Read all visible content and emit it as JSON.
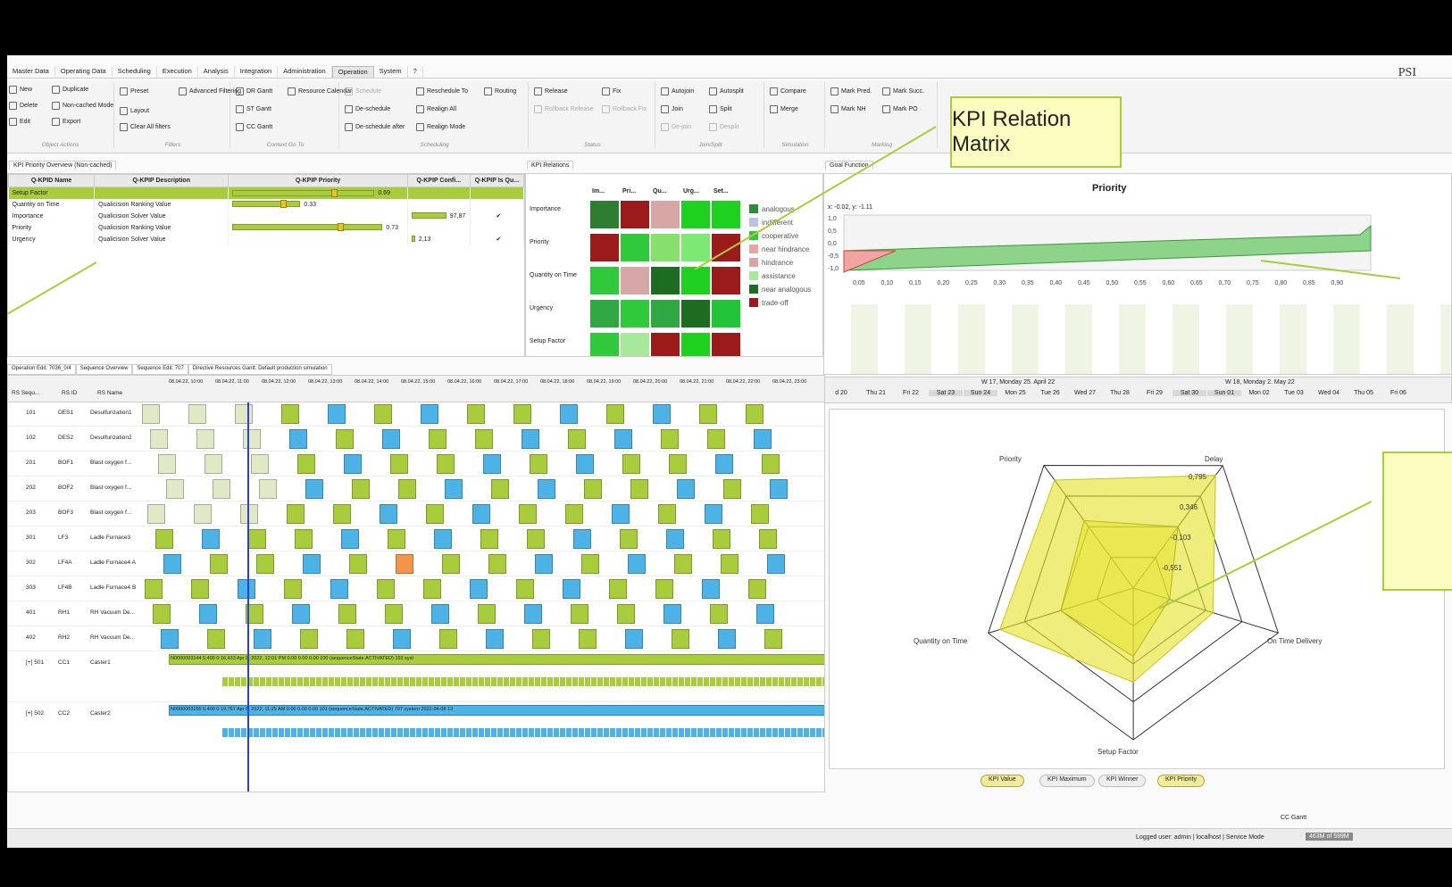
{
  "brand": "PSI",
  "menu": [
    "Master Data",
    "Operating Data",
    "Scheduling",
    "Execution",
    "Analysis",
    "Integration",
    "Administration",
    "Operation",
    "System",
    "?"
  ],
  "menu_active_index": 7,
  "ribbon": {
    "object_actions": {
      "label": "Object Actions",
      "new": "New",
      "duplicate": "Duplicate",
      "delete": "Delete",
      "non_cached": "Non-cached Mode",
      "edit": "Edit",
      "export": "Export"
    },
    "filters": {
      "label": "Filters",
      "preset": "Preset",
      "advanced": "Advanced Filtering",
      "layout": "Layout",
      "clear": "Clear All filters"
    },
    "context": {
      "label": "Context Go To",
      "dr_gantt": "DR Gantt",
      "resource_calendar": "Resource Calendar",
      "st_gantt": "ST Gantt",
      "cc_gantt": "CC Gantt"
    },
    "scheduling": {
      "label": "Scheduling",
      "schedule": "Schedule",
      "reschedule_to": "Reschedule To",
      "routing": "Routing",
      "deschedule": "De-schedule",
      "realign_all": "Realign All",
      "deschedule_after": "De-schedule after",
      "realign_mode": "Realign Mode"
    },
    "status": {
      "label": "Status",
      "release": "Release",
      "fix": "Fix",
      "rollback_release": "Rollback Release",
      "rollback_fix": "Rollback Fix"
    },
    "join_split": {
      "label": "Join/Split",
      "autojoin": "Autojoin",
      "autosplit": "Autosplit",
      "join": "Join",
      "split": "Split",
      "dejoin": "De-join",
      "desplit": "Desplit"
    },
    "simulation": {
      "label": "Simulation",
      "compare": "Compare",
      "merge": "Merge"
    },
    "marking": {
      "label": "Marking",
      "mark_pred": "Mark Pred.",
      "mark_succ": "Mark Succ.",
      "mark_nh": "Mark NH",
      "mark_po": "Mark PO"
    }
  },
  "priority_panel": {
    "tab": "KPI Priority Overview (Non-cached)",
    "columns": [
      "Q-KPID Name",
      "Q-KPIP Description",
      "Q-KPIP Priority",
      "Q-KPIP Confi...",
      "Q-KPIP Is Qu..."
    ],
    "rows": [
      {
        "name": "Setup Factor",
        "desc": "",
        "priority": 0.69,
        "priority_text": "0.69",
        "conf": null,
        "conf_text": "",
        "is_qu": ""
      },
      {
        "name": "Quantity on Time",
        "desc": "Qualicision Ranking Value",
        "priority": 0.33,
        "priority_text": "0.33",
        "conf": null,
        "conf_text": "",
        "is_qu": ""
      },
      {
        "name": "Importance",
        "desc": "Qualicision Solver Value",
        "priority": null,
        "priority_text": "",
        "conf": 0.98,
        "conf_text": "97,87",
        "is_qu": "✔"
      },
      {
        "name": "Priority",
        "desc": "Qualicision Ranking Value",
        "priority": 0.73,
        "priority_text": "0.73",
        "conf": null,
        "conf_text": "",
        "is_qu": ""
      },
      {
        "name": "Urgency",
        "desc": "Qualicision Solver Value",
        "priority": null,
        "priority_text": "",
        "conf": 0.1,
        "conf_text": "2,13",
        "is_qu": "✔"
      }
    ]
  },
  "relations_panel": {
    "tab": "KPI Relations",
    "columns": [
      "Im...",
      "Pri...",
      "Qu...",
      "Urg...",
      "Set..."
    ],
    "rows": [
      "Importance",
      "Priority",
      "Quantity on Time",
      "Urgency",
      "Setup Factor"
    ],
    "matrix": [
      [
        "#2e7d32",
        "#9b1b1b",
        "#d7a7a7",
        "#1fd11f",
        "#1fd11f"
      ],
      [
        "#9b1b1b",
        "#2fc93b",
        "#88e06c",
        "#7de873",
        "#9b1b1b"
      ],
      [
        "#2fc93b",
        "#d7a7a7",
        "#1e6b22",
        "#1fd11f",
        "#9b1b1b"
      ],
      [
        "#2fa844",
        "#2fc93b",
        "#2fa844",
        "#1e6b22",
        "#22c43a"
      ],
      [
        "#2fc93b",
        "#a8e89a",
        "#9b1b1b",
        "#1fd11f",
        "#9b1b1b"
      ]
    ],
    "legend": [
      {
        "label": "analogous",
        "color": "#2e8b3a"
      },
      {
        "label": "indifferent",
        "color": "#b9c3e6"
      },
      {
        "label": "cooperative",
        "color": "#2fc93b"
      },
      {
        "label": "near hindrance",
        "color": "#e8a3a3"
      },
      {
        "label": "hindrance",
        "color": "#d7a7a7"
      },
      {
        "label": "assistance",
        "color": "#a8e89a"
      },
      {
        "label": "near analogous",
        "color": "#1e6b22"
      },
      {
        "label": "trade-off",
        "color": "#9b1b1b"
      }
    ]
  },
  "callouts": {
    "kpi_relation_matrix": "KPI Relation Matrix"
  },
  "goal_panel": {
    "tab": "Goal Function",
    "chart_title": "Priority",
    "coords": "x: -0.02, y: -1.11",
    "y_ticks": [
      "1,0",
      "0,5",
      "0,0",
      "-0,5",
      "-1,0"
    ],
    "x_ticks": [
      "0,05",
      "0,10",
      "0,15",
      "0,20",
      "0,25",
      "0,30",
      "0,35",
      "0,40",
      "0,45",
      "0,50",
      "0,55",
      "0,60",
      "0,65",
      "0,70",
      "0,75",
      "0,80",
      "0,85",
      "0,90"
    ]
  },
  "timeline": {
    "weeks": [
      "W 17, Monday 25. April 22",
      "W 18, Monday 2. May 22"
    ],
    "days": [
      "d 20",
      "Thu 21",
      "Fri 22",
      "Sat 23",
      "Sun 24",
      "Mon 25",
      "Tue 26",
      "Wed 27",
      "Thu 28",
      "Fri 29",
      "Sat 30",
      "Sun 01",
      "Mon 02",
      "Tue 03",
      "Wed 04",
      "Thu 05",
      "Fri 06"
    ]
  },
  "radar": {
    "axes": [
      "Priority",
      "Delay",
      "On Time Delivery",
      "Setup Factor",
      "Quantity on Time"
    ],
    "ring_labels": [
      "0,795",
      "0,346",
      "-0,103",
      "-0,551"
    ],
    "outer": [
      0.88,
      0.92,
      0.55,
      0.62,
      0.92
    ],
    "inner": [
      0.55,
      0.5,
      0.25,
      0.45,
      0.5
    ],
    "buttons": [
      "KPI Value",
      "KPI Maximum",
      "KPI Winner",
      "KPI Priority"
    ],
    "active_buttons": [
      0,
      3
    ]
  },
  "gantt_tabs": [
    "Operation Edit: 7036_0/4",
    "Sequence Overview",
    "Sequence Edit: 707",
    "Directive Resources Gantt: Default production simulation"
  ],
  "gantt": {
    "columns": [
      "RS Sequ...",
      "RS ID",
      "RS Name"
    ],
    "rows": [
      {
        "seq": "101",
        "id": "DES1",
        "name": "Desulfurization1"
      },
      {
        "seq": "102",
        "id": "DES2",
        "name": "Desulfurization2"
      },
      {
        "seq": "201",
        "id": "BOF1",
        "name": "Blast oxygen f..."
      },
      {
        "seq": "202",
        "id": "BOF2",
        "name": "Blast oxygen f..."
      },
      {
        "seq": "203",
        "id": "BOF3",
        "name": "Blast oxygen f..."
      },
      {
        "seq": "301",
        "id": "LF3",
        "name": "Ladle Furnace3"
      },
      {
        "seq": "302",
        "id": "LF4A",
        "name": "Ladle Furnace4 A"
      },
      {
        "seq": "303",
        "id": "LF4B",
        "name": "Ladle Furnace4 B"
      },
      {
        "seq": "401",
        "id": "RH1",
        "name": "RH Vacuum De..."
      },
      {
        "seq": "402",
        "id": "RH2",
        "name": "RH Vacuum De..."
      },
      {
        "seq": "[+] 501",
        "id": "CC1",
        "name": "Caster1"
      },
      {
        "seq": "[+] 502",
        "id": "CC2",
        "name": "Caster2"
      }
    ],
    "time_header": [
      "08.04.22, 10:00",
      "08.04.22, 11:00",
      "08.04.22, 12:00",
      "08.04.22, 13:00",
      "08.04.22, 14:00",
      "08.04.22, 15:00",
      "08.04.22, 16:00",
      "08.04.22, 17:00",
      "08.04.22, 18:00",
      "08.04.22, 19:00",
      "08.04.22, 20:00",
      "08.04.22, 21:00",
      "08.04.22, 22:00",
      "08.04.22, 23:00"
    ],
    "caster1_info": "N0000003144 5,400 0 16,433 Apr 8, 2022, 12:01 PM 0.00 0.00 0.00 100 (sequenceState.ACTIVATED) 193 syst",
    "caster2_info": "N0000003155 5,400 0 19,767 Apr 8, 2022, 11:25 AM 0.00 0.00 0.00 101 (sequenceState.ACTIVATED) 707 system 2022-04-08 13"
  },
  "status_bar": {
    "user": "Logged user: admin | localhost | Service Mode",
    "memory": "463M of 599M",
    "cc_gantt": "CC Gantt"
  }
}
